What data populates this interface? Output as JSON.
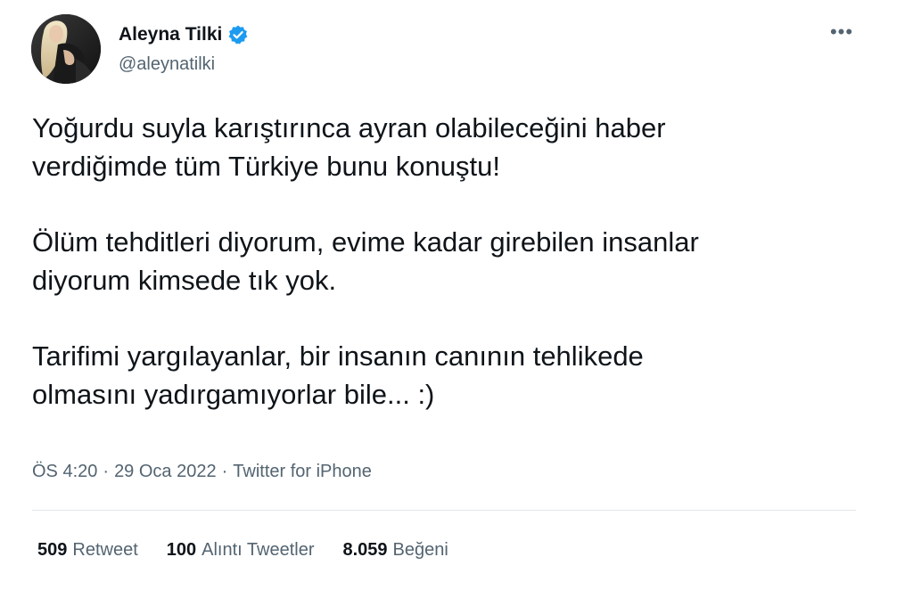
{
  "author": {
    "name": "Aleyna Tilki",
    "handle": "@aleynatilki",
    "verified": true,
    "avatar_icon": "profile-photo"
  },
  "menu_icon": "more-horizontal-icon",
  "tweet": {
    "paragraphs": [
      "Yoğurdu suyla karıştırınca ayran olabileceğini haber\nverdiğimde tüm Türkiye bunu konuştu!",
      "Ölüm tehditleri diyorum, evime kadar girebilen insanlar\ndiyorum kimsede tık yok.",
      "Tarifimi yargılayanlar, bir insanın canının tehlikede\nolmasını yadırgamıyorlar bile... :)"
    ],
    "time": "ÖS 4:20",
    "date": "29 Oca 2022",
    "source": "Twitter for iPhone",
    "separator": "·"
  },
  "stats": [
    {
      "count": "509",
      "label": "Retweet"
    },
    {
      "count": "100",
      "label": "Alıntı Tweetler"
    },
    {
      "count": "8.059",
      "label": "Beğeni"
    }
  ],
  "colors": {
    "text_primary": "#0f1419",
    "text_secondary": "#536471",
    "verified_badge": "#1d9bf0",
    "divider": "#e3e6e9"
  }
}
